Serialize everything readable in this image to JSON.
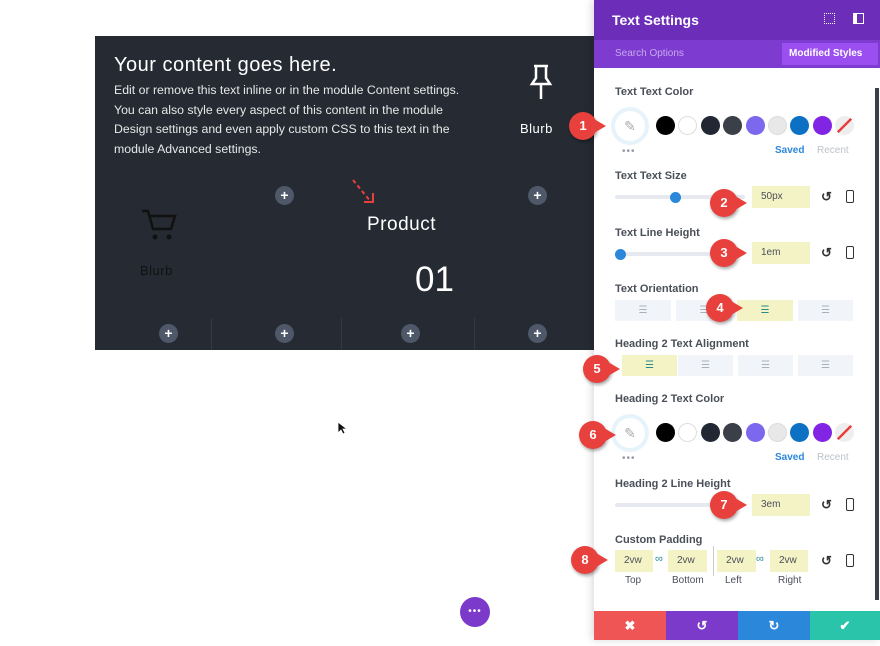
{
  "canvas": {
    "heading": "Your content goes here.",
    "paragraph": "Edit or remove this text inline or in the module Content settings. You can also style every aspect of this content in the module Design settings and even apply custom CSS to this text in the module Advanced settings.",
    "blurb_top": "Blurb",
    "blurb_left": "Blurb",
    "product": "Product",
    "number": "01",
    "plus": "+"
  },
  "panel": {
    "title": "Text Settings",
    "search_placeholder": "Search Options",
    "modified_styles": "Modified Styles",
    "close": "✖",
    "text_color_label": "Text Text Color",
    "text_size_label": "Text Text Size",
    "text_size_value": "50px",
    "text_size_slider_percent": 60,
    "line_height_label": "Text Line Height",
    "line_height_value": "1em",
    "line_height_slider_percent": 0,
    "orientation_label": "Text Orientation",
    "orientation_selected": "center",
    "h2_align_label": "Heading 2 Text Alignment",
    "h2_align_selected": "left",
    "h2_color_label": "Heading 2 Text Color",
    "h2_line_height_label": "Heading 2 Line Height",
    "h2_line_height_value": "3em",
    "padding_label": "Custom Padding",
    "padding": {
      "top": "2vw",
      "bottom": "2vw",
      "left": "2vw",
      "right": "2vw",
      "top_label": "Top",
      "bottom_label": "Bottom",
      "left_label": "Left",
      "right_label": "Right"
    },
    "saved": "Saved",
    "recent": "Recent",
    "more": "•••",
    "swatches": [
      "#000000",
      "#ffffff",
      "#222833",
      "#3b3f47",
      "#7b68ee",
      "#e8e8e8",
      "#0c71c3",
      "#8224e3",
      "none"
    ]
  },
  "footer": {
    "cancel": "✖",
    "undo": "↺",
    "redo": "↻",
    "save": "✔",
    "colors": {
      "cancel": "#ef5555",
      "undo": "#7b3ac9",
      "redo": "#2b87da",
      "save": "#29c4a9"
    }
  },
  "markers": [
    "1",
    "2",
    "3",
    "4",
    "5",
    "6",
    "7",
    "8"
  ],
  "fab": "•••"
}
